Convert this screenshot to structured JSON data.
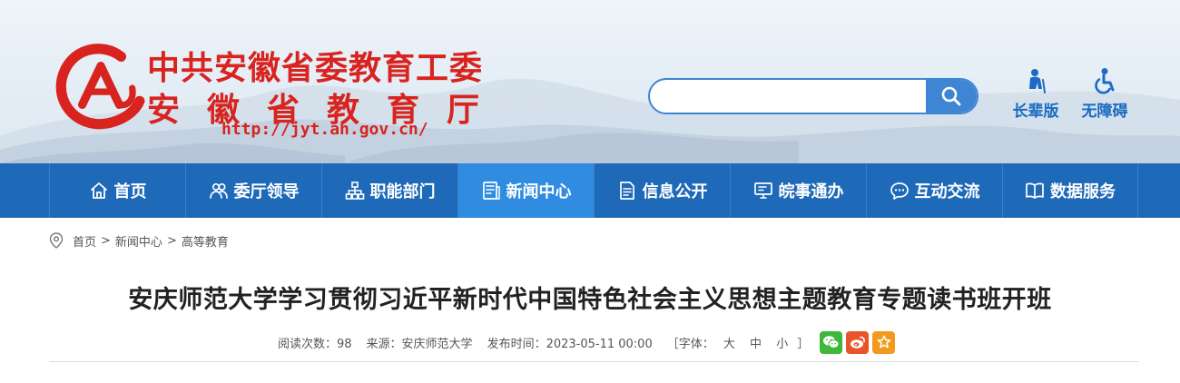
{
  "header": {
    "org_line1": "中共安徽省委教育工委",
    "org_line2": "安徽省教育厅",
    "url": "http://jyt.ah.gov.cn/",
    "brand_color": "#d8231f"
  },
  "search": {
    "placeholder": "",
    "value": "",
    "icon": "search-icon"
  },
  "tools": [
    {
      "label": "长辈版",
      "icon": "elder-icon"
    },
    {
      "label": "无障碍",
      "icon": "wheelchair-icon"
    }
  ],
  "nav": {
    "items": [
      {
        "label": "首页",
        "icon": "home-icon"
      },
      {
        "label": "委厅领导",
        "icon": "leaders-icon"
      },
      {
        "label": "职能部门",
        "icon": "org-chart-icon"
      },
      {
        "label": "新闻中心",
        "icon": "news-icon",
        "active": true
      },
      {
        "label": "信息公开",
        "icon": "document-icon"
      },
      {
        "label": "皖事通办",
        "icon": "monitor-icon"
      },
      {
        "label": "互动交流",
        "icon": "chat-icon"
      },
      {
        "label": "数据服务",
        "icon": "book-icon"
      }
    ],
    "bg_color": "#1e69b8",
    "active_color": "#2f8ce0"
  },
  "breadcrumb": {
    "items": [
      "首页",
      "新闻中心",
      "高等教育"
    ],
    "separator": ">"
  },
  "article": {
    "title": "安庆师范大学学习贯彻习近平新时代中国特色社会主义思想主题教育专题读书班开班",
    "views": "阅读次数：98",
    "source": "来源：安庆师范大学",
    "published": "发布时间：2023-05-11 00:00",
    "font_label_open": "［字体：",
    "font_sizes": [
      "大",
      "中",
      "小"
    ],
    "font_label_close": "］"
  },
  "share": [
    {
      "icon": "wechat-icon",
      "color": "#3fb83a"
    },
    {
      "icon": "weibo-icon",
      "color": "#e8552a"
    },
    {
      "icon": "favorite-star-icon",
      "color": "#f39a1e"
    }
  ]
}
